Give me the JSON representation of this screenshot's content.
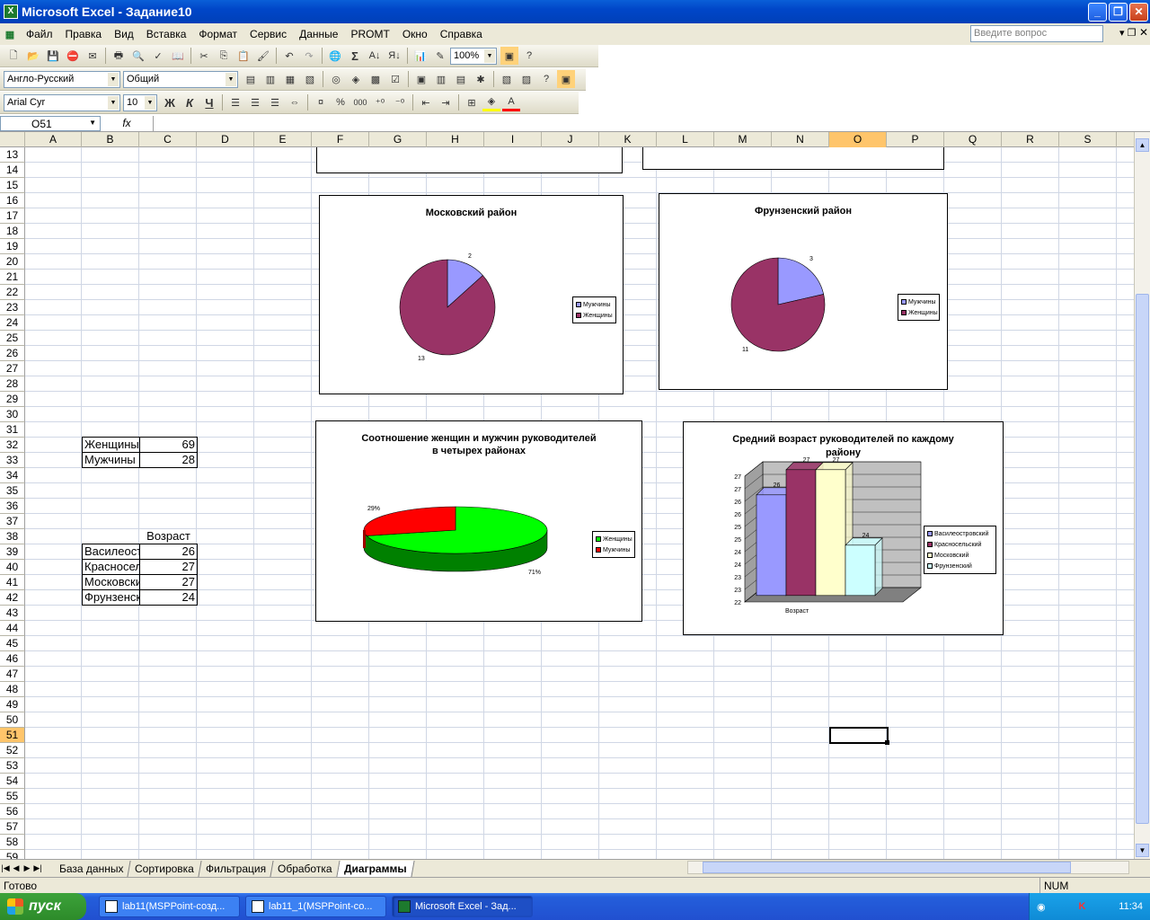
{
  "window": {
    "title": "Microsoft Excel - Задание10"
  },
  "menu": {
    "items": [
      "Файл",
      "Правка",
      "Вид",
      "Вставка",
      "Формат",
      "Сервис",
      "Данные",
      "PROMT",
      "Окно",
      "Справка"
    ],
    "help_placeholder": "Введите вопрос"
  },
  "toolbar": {
    "zoom": "100%",
    "translation_dir": "Англо-Русский",
    "number_format": "Общий",
    "font": "Arial Cyr",
    "font_size": "10",
    "bold": "Ж",
    "italic": "К",
    "underline": "Ч",
    "percent": "%",
    "thousands": "000",
    "sigma": "Σ"
  },
  "formula": {
    "name_box": "O51",
    "fx": "fx",
    "value": ""
  },
  "columns": [
    "A",
    "B",
    "C",
    "D",
    "E",
    "F",
    "G",
    "H",
    "I",
    "J",
    "K",
    "L",
    "M",
    "N",
    "O",
    "P",
    "Q",
    "R",
    "S"
  ],
  "selected_column": "O",
  "rows": [
    "13",
    "14",
    "15",
    "16",
    "17",
    "18",
    "19",
    "20",
    "21",
    "22",
    "23",
    "24",
    "25",
    "26",
    "27",
    "28",
    "29",
    "30",
    "31",
    "32",
    "33",
    "34",
    "35",
    "36",
    "37",
    "38",
    "39",
    "40",
    "41",
    "42",
    "43",
    "44",
    "45",
    "46",
    "47",
    "48",
    "49",
    "50",
    "51",
    "52",
    "53",
    "54",
    "55",
    "56",
    "57",
    "58",
    "59"
  ],
  "selected_row": "51",
  "cells": {
    "b32": "Женщины",
    "c32": "69",
    "b33": "Мужчины",
    "c33": "28",
    "c38": "Возраст",
    "b39": "Василеостровский",
    "c39": "26",
    "b40": "Красносельский",
    "c40": "27",
    "b41": "Московский",
    "c41": "27",
    "b42": "Фрунзенский",
    "c42": "24"
  },
  "chart_data": [
    {
      "type": "pie",
      "title": "Московский район",
      "categories": [
        "Мужчины",
        "Женщины"
      ],
      "values": [
        2,
        13
      ],
      "data_labels": [
        "2",
        "13"
      ],
      "colors": [
        "#9999ff",
        "#993366"
      ],
      "legend": "right"
    },
    {
      "type": "pie",
      "title": "Фрунзенский район",
      "categories": [
        "Мужчины",
        "Женщины"
      ],
      "values": [
        3,
        11
      ],
      "data_labels": [
        "3",
        "11"
      ],
      "colors": [
        "#9999ff",
        "#993366"
      ],
      "legend": "right"
    },
    {
      "type": "pie",
      "title": "Соотношение женщин и мужчин руководителей в четырех районах",
      "title_lines": [
        "Соотношение женщин и мужчин руководителей",
        "в четырех районах"
      ],
      "categories": [
        "Женщины",
        "Мужчины"
      ],
      "values": [
        71,
        29
      ],
      "data_labels": [
        "71%",
        "29%"
      ],
      "colors": [
        "#00ff00",
        "#ff0000"
      ],
      "legend": "right"
    },
    {
      "type": "bar",
      "title": "Средний возраст руководителей по каждому району",
      "title_lines": [
        "Средний возраст руководителей по каждому",
        "району"
      ],
      "categories": [
        "Возраст"
      ],
      "xlabel": "Возраст",
      "series": [
        {
          "name": "Василеостровский",
          "values": [
            26
          ]
        },
        {
          "name": "Красносельский",
          "values": [
            27
          ]
        },
        {
          "name": "Московский",
          "values": [
            27
          ]
        },
        {
          "name": "Фрунзенский",
          "values": [
            24
          ]
        }
      ],
      "data_labels": [
        "26",
        "27",
        "27",
        "24"
      ],
      "colors": [
        "#9999ff",
        "#993366",
        "#ffffcc",
        "#ccffff"
      ],
      "ylim": [
        22,
        27
      ],
      "yticks": [
        "22",
        "23",
        "23",
        "24",
        "24",
        "25",
        "25",
        "26",
        "26",
        "27",
        "27"
      ],
      "legend_labels": [
        "Василеостровский",
        "Красносельский",
        "Московский",
        "Фрунзенский"
      ],
      "legend": "right",
      "grid": true
    }
  ],
  "sheets": {
    "tabs": [
      "База данных",
      "Сортировка",
      "Фильтрация",
      "Обработка",
      "Диаграммы"
    ],
    "active": "Диаграммы"
  },
  "status": {
    "ready": "Готово",
    "num": "NUM"
  },
  "taskbar": {
    "start": "пуск",
    "tasks": [
      "lab11(MSPPoint-созд...",
      "lab11_1(MSPPoint-со...",
      "Microsoft Excel - Зад..."
    ],
    "lang": "RU",
    "clock": "11:34"
  }
}
